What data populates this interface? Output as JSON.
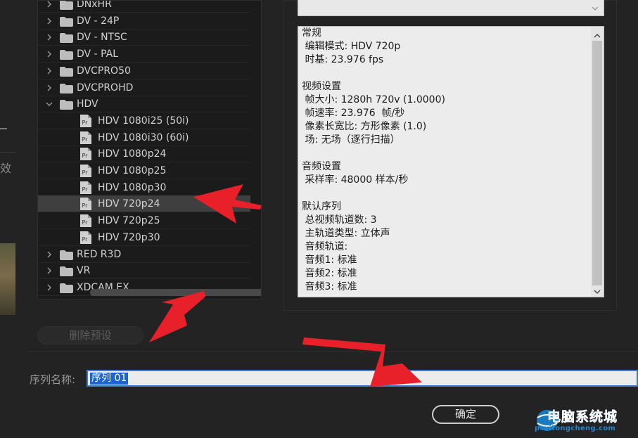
{
  "side_panel": {
    "clipped_label": "效"
  },
  "preset_tree": {
    "items": [
      {
        "label": "DNxHR",
        "type": "folder",
        "expanded": false
      },
      {
        "label": "DV - 24P",
        "type": "folder",
        "expanded": false
      },
      {
        "label": "DV - NTSC",
        "type": "folder",
        "expanded": false
      },
      {
        "label": "DV - PAL",
        "type": "folder",
        "expanded": false
      },
      {
        "label": "DVCPRO50",
        "type": "folder",
        "expanded": false
      },
      {
        "label": "DVCPROHD",
        "type": "folder",
        "expanded": false
      },
      {
        "label": "HDV",
        "type": "folder",
        "expanded": true
      },
      {
        "label": "HDV 1080i25 (50i)",
        "type": "preset",
        "icon": "Pr"
      },
      {
        "label": "HDV 1080i30 (60i)",
        "type": "preset",
        "icon": "Pr"
      },
      {
        "label": "HDV 1080p24",
        "type": "preset",
        "icon": "Pr"
      },
      {
        "label": "HDV 1080p25",
        "type": "preset",
        "icon": "Pr"
      },
      {
        "label": "HDV 1080p30",
        "type": "preset",
        "icon": "Pr"
      },
      {
        "label": "HDV 720p24",
        "type": "preset",
        "icon": "Pr",
        "selected": true
      },
      {
        "label": "HDV 720p25",
        "type": "preset",
        "icon": "Pr"
      },
      {
        "label": "HDV 720p30",
        "type": "preset",
        "icon": "Pr"
      },
      {
        "label": "RED R3D",
        "type": "folder",
        "expanded": false
      },
      {
        "label": "VR",
        "type": "folder",
        "expanded": false
      },
      {
        "label": "XDCAM EX",
        "type": "folder",
        "expanded": false
      }
    ]
  },
  "description": {
    "lines": [
      "常规",
      " 编辑模式: HDV 720p",
      " 时基: 23.976 fps",
      "",
      "视频设置",
      " 帧大小: 1280h 720v (1.0000)",
      " 帧速率: 23.976  帧/秒",
      " 像素长宽比: 方形像素 (1.0)",
      " 场: 无场（逐行扫描）",
      "",
      "音频设置",
      " 采样率: 48000 样本/秒",
      "",
      "默认序列",
      " 总视频轨道数: 3",
      " 主轨道类型: 立体声",
      " 音频轨道:",
      " 音频1: 标准",
      " 音频2: 标准",
      " 音频3: 标准"
    ]
  },
  "delete_preset_button": "删除预设",
  "sequence_name": {
    "label": "序列名称:",
    "value": "序列 01"
  },
  "ok_button": "确定",
  "watermark": {
    "text": "电脑系统城",
    "url": "pcxitongcheng.com"
  },
  "colors": {
    "annotation_arrow": "#e8202a",
    "selection_blue": "#1b64d1",
    "selected_row": "#3f3f3f",
    "watermark": "#1a8ad8"
  }
}
